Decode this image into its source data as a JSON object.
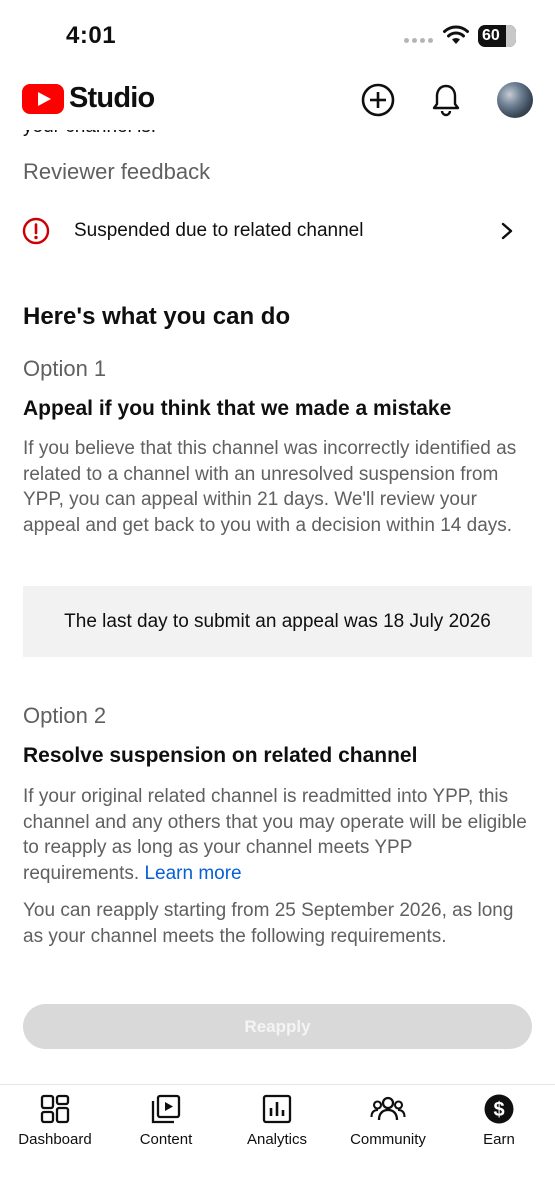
{
  "status_bar": {
    "time": "4:01",
    "battery": "60"
  },
  "header": {
    "logo_text": "Studio",
    "icons": [
      "create-icon",
      "bell-icon",
      "avatar"
    ]
  },
  "content": {
    "peek_text": "your channel is.",
    "reviewer_feedback_label": "Reviewer feedback",
    "reviewer_item": "Suspended due to related channel",
    "what_you_can_do": "Here's what you can do",
    "option1": {
      "label": "Option 1",
      "title": "Appeal if you think that we made a mistake",
      "body": "If you believe that this channel was incorrectly identified as related to a channel with an unresolved suspension from YPP, you can appeal within 21 days. We'll review your appeal and get back to you with a decision within 14 days.",
      "deadline": "The last day to submit an appeal was 18 July 2026"
    },
    "option2": {
      "label": "Option 2",
      "title": "Resolve suspension on related channel",
      "body": "If your original related channel is readmitted into YPP, this channel and any others that you may operate will be eligible to reapply as long as your channel meets YPP requirements.",
      "learn_more": "Learn more",
      "reapply_info": "You can reapply starting from 25 September 2026, as long as your channel meets the following requirements."
    },
    "reapply_button": "Reapply"
  },
  "bottom_nav": {
    "items": [
      {
        "label": "Dashboard",
        "icon": "dashboard-icon"
      },
      {
        "label": "Content",
        "icon": "content-icon"
      },
      {
        "label": "Analytics",
        "icon": "analytics-icon"
      },
      {
        "label": "Community",
        "icon": "community-icon"
      },
      {
        "label": "Earn",
        "icon": "earn-icon"
      }
    ]
  },
  "colors": {
    "brand_red": "#ff0000",
    "warning_red": "#cc0000",
    "link_blue": "#065fd4",
    "secondary_text": "#606060",
    "disabled_button": "#d9d9d9"
  }
}
